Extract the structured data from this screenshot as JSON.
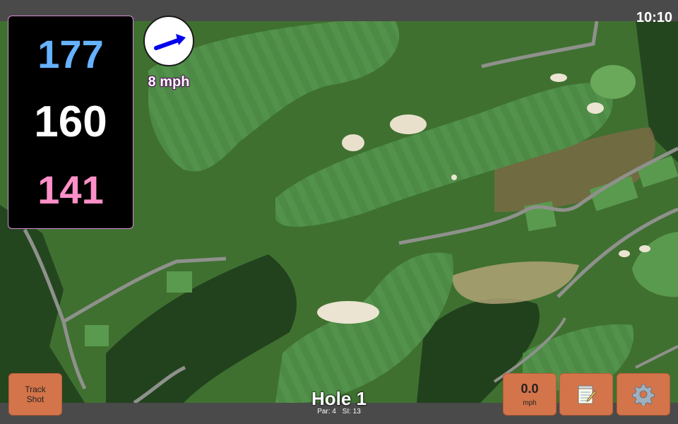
{
  "status": {
    "time": "10:10"
  },
  "yardages": {
    "back": "177",
    "middle": "160",
    "front": "141"
  },
  "wind": {
    "speed_label": "8 mph",
    "arrow_color": "#0000ee"
  },
  "hole": {
    "title": "Hole 1",
    "par_label": "Par: 4",
    "si_label": "SI: 13"
  },
  "buttons": {
    "track_shot_line1": "Track",
    "track_shot_line2": "Shot",
    "speed_value": "0.0",
    "speed_unit": "mph",
    "notes_icon": "notepad-icon",
    "settings_icon": "gear-icon"
  },
  "colors": {
    "button": "#d4744a",
    "back_yardage": "#66b2ff",
    "middle_yardage": "#ffffff",
    "front_yardage": "#ff8fc8"
  }
}
